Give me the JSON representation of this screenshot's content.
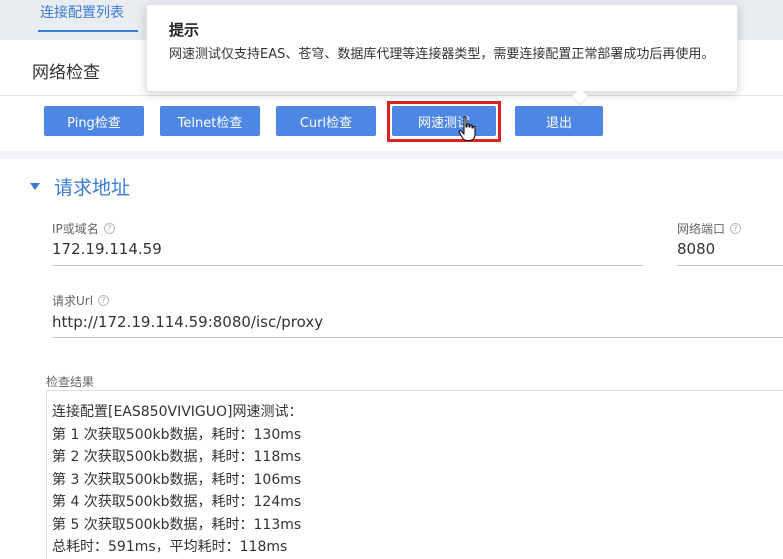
{
  "background": {
    "tab_label": "连接配置列表"
  },
  "dialog": {
    "title": "网络检查"
  },
  "toolbar": {
    "ping": "Ping检查",
    "telnet": "Telnet检查",
    "curl": "Curl检查",
    "speed_test": "网速测试",
    "exit": "退出"
  },
  "tooltip": {
    "title": "提示",
    "body": "网速测试仅支持EAS、苍穹、数据库代理等连接器类型，需要连接配置正常部署成功后再使用。"
  },
  "section": {
    "title": "请求地址"
  },
  "form": {
    "ip_label": "IP或域名",
    "ip_value": "172.19.114.59",
    "port_label": "网络端口",
    "port_value": "8080",
    "url_label": "请求Url",
    "url_value": "http://172.19.114.59:8080/isc/proxy"
  },
  "result": {
    "label": "检查结果",
    "lines": [
      "连接配置[EAS850VIVIGUO]网速测试：",
      "第 1 次获取500kb数据，耗时：130ms",
      "第 2 次获取500kb数据，耗时：118ms",
      "第 3 次获取500kb数据，耗时：106ms",
      "第 4 次获取500kb数据，耗时：124ms",
      "第 5 次获取500kb数据，耗时：113ms",
      "总耗时：591ms，平均耗时：118ms"
    ]
  },
  "colors": {
    "accent": "#4e87e3",
    "highlight": "#e02020",
    "link": "#3a7bd5"
  },
  "icons": {
    "help": "help-circle-icon",
    "cursor": "hand-pointer-icon",
    "collapse": "caret-down-icon"
  }
}
